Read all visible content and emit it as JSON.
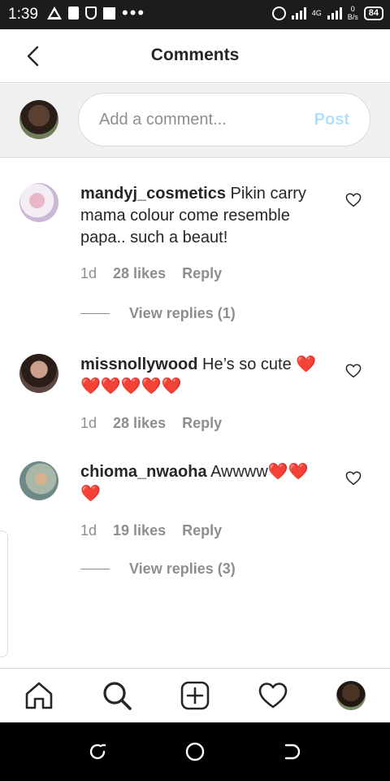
{
  "status_bar": {
    "time": "1:39",
    "net_speed_value": "0",
    "net_speed_unit": "B/s",
    "network_type": "4G",
    "battery": "84"
  },
  "header": {
    "title": "Comments"
  },
  "composer": {
    "placeholder": "Add a comment...",
    "post_label": "Post"
  },
  "comments": [
    {
      "username": "mandyj_cosmetics",
      "text": "Pikin carry mama colour come resemble papa.. such a beaut!",
      "time": "1d",
      "likes": "28 likes",
      "reply_label": "Reply",
      "view_replies": "View replies (1)"
    },
    {
      "username": "missnollywood",
      "text": "He’s so cute ❤️❤️❤️❤️❤️❤️",
      "time": "1d",
      "likes": "28 likes",
      "reply_label": "Reply"
    },
    {
      "username": "chioma_nwaoha",
      "text": "Awwww❤️❤️❤️",
      "time": "1d",
      "likes": "19 likes",
      "reply_label": "Reply",
      "view_replies": "View replies (3)"
    }
  ],
  "colors": {
    "text": "#262626",
    "secondary": "#8e8e8e",
    "post_disabled": "#b2dffc",
    "divider": "#dbdbdb",
    "composer_bg": "#f0f0f0",
    "heart_emoji": "#e0245e"
  },
  "icons": {
    "tab_bar": [
      "home-icon",
      "search-icon",
      "add-post-icon",
      "activity-heart-icon",
      "profile-avatar"
    ],
    "system_nav": [
      "recent-apps-icon",
      "home-circle-icon",
      "back-icon"
    ]
  }
}
